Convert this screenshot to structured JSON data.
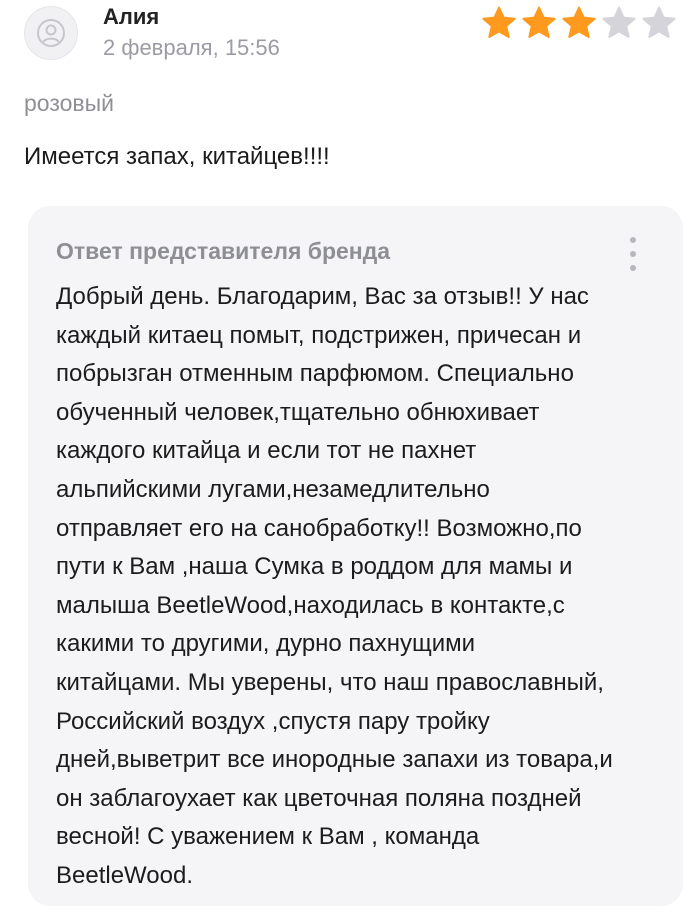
{
  "author": {
    "name": "Алия",
    "date": "2 февраля, 15:56",
    "avatar_icon": "user-icon"
  },
  "rating": {
    "value": 3,
    "max": 5,
    "filled_color": "#ff9a1f",
    "empty_color": "#d4d4da"
  },
  "review": {
    "variant": "розовый",
    "text": "Имеется запах, китайцев!!!!"
  },
  "reply": {
    "title": "Ответ представителя бренда",
    "menu_icon": "more-vertical-icon",
    "text": "Добрый день. Благодарим, Вас за отзыв!! У нас\nкаждый китаец помыт, подстрижен, причесан и\nпобрызган отменным парфюмом. Специально\nобученный человек,тщательно обнюхивает\nкаждого китайца и если тот не пахнет\nальпийскими лугами,незамедлительно\nотправляет его на санобработку!! Возможно,по\nпути к Вам ,наша  Сумка в роддом для мамы и\nмалыша BeetleWood,находилась в контакте,с\nкакими то другими, дурно пахнущими\nкитайцами. Мы уверены, что наш православный,\nРоссийский воздух ,спустя пару тройку\nдней,выветрит все инородные запахи из товара,и\nон заблагоухает как цветочная поляна поздней\nвесной! С уважением к Вам , команда\nBeetleWood."
  }
}
